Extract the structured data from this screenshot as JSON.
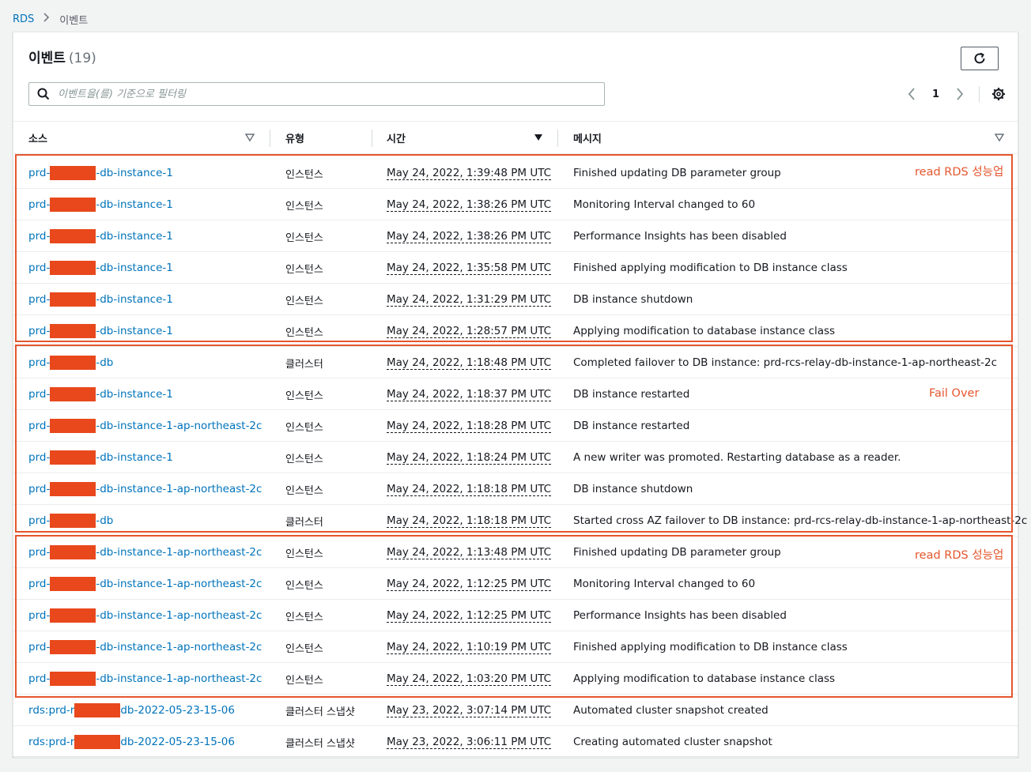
{
  "breadcrumb": {
    "root": "RDS",
    "current": "이벤트"
  },
  "panel": {
    "title": "이벤트",
    "count": "(19)",
    "search_placeholder": "이벤트을(를) 기준으로 필터링",
    "page": "1"
  },
  "columns": {
    "source": "소스",
    "type": "유형",
    "time": "시간",
    "message": "메시지"
  },
  "annotations": {
    "group1": "read RDS 성능업",
    "group2": "Fail Over",
    "group3": "read RDS 성능업"
  },
  "rows": [
    {
      "src_pre": "prd-",
      "src_post": "-db-instance-1",
      "type": "인스턴스",
      "time": "May 24, 2022, 1:39:48 PM UTC",
      "message": "Finished updating DB parameter group"
    },
    {
      "src_pre": "prd-",
      "src_post": "-db-instance-1",
      "type": "인스턴스",
      "time": "May 24, 2022, 1:38:26 PM UTC",
      "message": "Monitoring Interval changed to 60"
    },
    {
      "src_pre": "prd-",
      "src_post": "-db-instance-1",
      "type": "인스턴스",
      "time": "May 24, 2022, 1:38:26 PM UTC",
      "message": "Performance Insights has been disabled"
    },
    {
      "src_pre": "prd-",
      "src_post": "-db-instance-1",
      "type": "인스턴스",
      "time": "May 24, 2022, 1:35:58 PM UTC",
      "message": "Finished applying modification to DB instance class"
    },
    {
      "src_pre": "prd-",
      "src_post": "-db-instance-1",
      "type": "인스턴스",
      "time": "May 24, 2022, 1:31:29 PM UTC",
      "message": "DB instance shutdown"
    },
    {
      "src_pre": "prd-",
      "src_post": "-db-instance-1",
      "type": "인스턴스",
      "time": "May 24, 2022, 1:28:57 PM UTC",
      "message": "Applying modification to database instance class"
    },
    {
      "src_pre": "prd-",
      "src_post": "-db",
      "type": "클러스터",
      "time": "May 24, 2022, 1:18:48 PM UTC",
      "message": "Completed failover to DB instance: prd-rcs-relay-db-instance-1-ap-northeast-2c"
    },
    {
      "src_pre": "prd-",
      "src_post": "-db-instance-1",
      "type": "인스턴스",
      "time": "May 24, 2022, 1:18:37 PM UTC",
      "message": "DB instance restarted"
    },
    {
      "src_pre": "prd-",
      "src_post": "-db-instance-1-ap-northeast-2c",
      "type": "인스턴스",
      "time": "May 24, 2022, 1:18:28 PM UTC",
      "message": "DB instance restarted"
    },
    {
      "src_pre": "prd-",
      "src_post": "-db-instance-1",
      "type": "인스턴스",
      "time": "May 24, 2022, 1:18:24 PM UTC",
      "message": "A new writer was promoted. Restarting database as a reader."
    },
    {
      "src_pre": "prd-",
      "src_post": "-db-instance-1-ap-northeast-2c",
      "type": "인스턴스",
      "time": "May 24, 2022, 1:18:18 PM UTC",
      "message": "DB instance shutdown"
    },
    {
      "src_pre": "prd-",
      "src_post": "-db",
      "type": "클러스터",
      "time": "May 24, 2022, 1:18:18 PM UTC",
      "message": "Started cross AZ failover to DB instance: prd-rcs-relay-db-instance-1-ap-northeast-2c"
    },
    {
      "src_pre": "prd-",
      "src_post": "-db-instance-1-ap-northeast-2c",
      "type": "인스턴스",
      "time": "May 24, 2022, 1:13:48 PM UTC",
      "message": "Finished updating DB parameter group"
    },
    {
      "src_pre": "prd-",
      "src_post": "-db-instance-1-ap-northeast-2c",
      "type": "인스턴스",
      "time": "May 24, 2022, 1:12:25 PM UTC",
      "message": "Monitoring Interval changed to 60"
    },
    {
      "src_pre": "prd-",
      "src_post": "-db-instance-1-ap-northeast-2c",
      "type": "인스턴스",
      "time": "May 24, 2022, 1:12:25 PM UTC",
      "message": "Performance Insights has been disabled"
    },
    {
      "src_pre": "prd-",
      "src_post": "-db-instance-1-ap-northeast-2c",
      "type": "인스턴스",
      "time": "May 24, 2022, 1:10:19 PM UTC",
      "message": "Finished applying modification to DB instance class"
    },
    {
      "src_pre": "prd-",
      "src_post": "-db-instance-1-ap-northeast-2c",
      "type": "인스턴스",
      "time": "May 24, 2022, 1:03:20 PM UTC",
      "message": "Applying modification to database instance class"
    },
    {
      "src_pre": "rds:prd-r",
      "src_post": "db-2022-05-23-15-06",
      "type": "클러스터 스냅샷",
      "time": "May 23, 2022, 3:07:14 PM UTC",
      "message": "Automated cluster snapshot created"
    },
    {
      "src_pre": "rds:prd-r",
      "src_post": "db-2022-05-23-15-06",
      "type": "클러스터 스냅샷",
      "time": "May 23, 2022, 3:06:11 PM UTC",
      "message": "Creating automated cluster snapshot"
    }
  ]
}
